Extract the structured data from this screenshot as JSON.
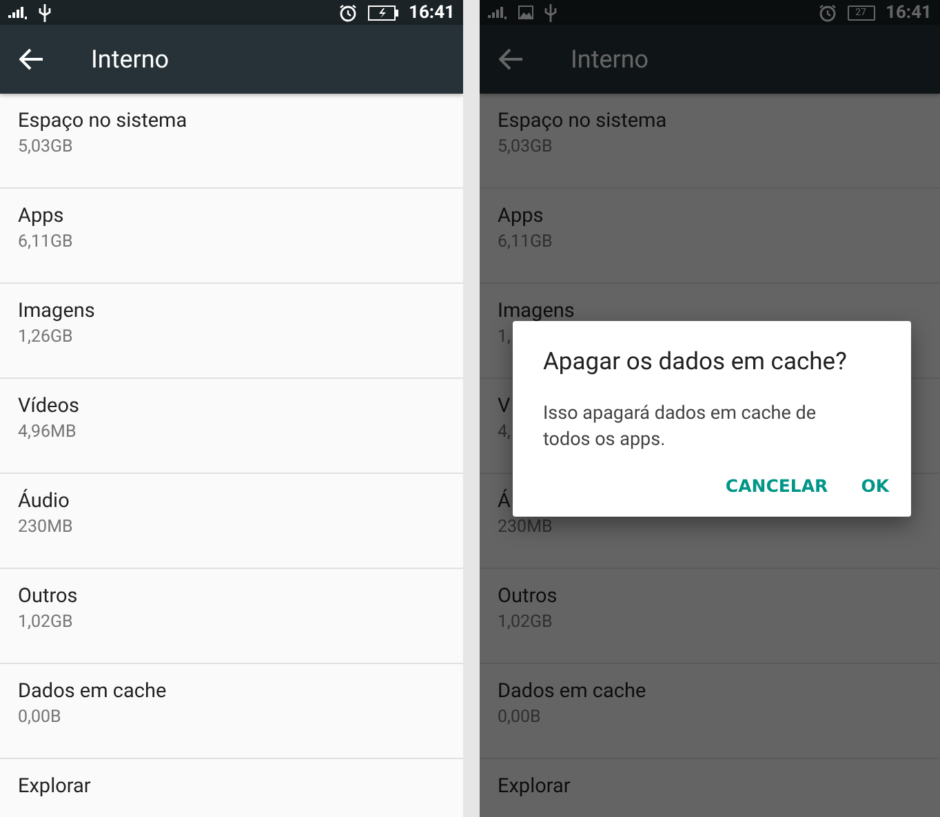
{
  "screens": [
    {
      "status_bar": {
        "image_notification": false,
        "battery": {
          "charging": true
        },
        "time": "16:41"
      },
      "toolbar": {
        "title": "Interno"
      },
      "items": [
        {
          "label": "Espaço no sistema",
          "value": "5,03GB"
        },
        {
          "label": "Apps",
          "value": "6,11GB"
        },
        {
          "label": "Imagens",
          "value": "1,26GB"
        },
        {
          "label": "Vídeos",
          "value": "4,96MB"
        },
        {
          "label": "Áudio",
          "value": "230MB"
        },
        {
          "label": "Outros",
          "value": "1,02GB"
        },
        {
          "label": "Dados em cache",
          "value": "0,00B"
        },
        {
          "label": "Explorar"
        }
      ]
    },
    {
      "status_bar": {
        "image_notification": true,
        "battery": {
          "charging": false,
          "text": "27"
        },
        "time": "16:41"
      },
      "toolbar": {
        "title": "Interno"
      },
      "items": [
        {
          "label": "Espaço no sistema",
          "value": "5,03GB"
        },
        {
          "label": "Apps",
          "value": "6,11GB"
        },
        {
          "label": "Imagens",
          "value": "1,"
        },
        {
          "label": "V",
          "value": "4,"
        },
        {
          "label": "Á",
          "value": "230MB"
        },
        {
          "label": "Outros",
          "value": "1,02GB"
        },
        {
          "label": "Dados em cache",
          "value": "0,00B"
        },
        {
          "label": "Explorar"
        }
      ],
      "dialog": {
        "title": "Apagar os dados em cache?",
        "message": "Isso apagará dados em cache de todos os apps.",
        "buttons": [
          "CANCELAR",
          "OK"
        ]
      }
    }
  ]
}
